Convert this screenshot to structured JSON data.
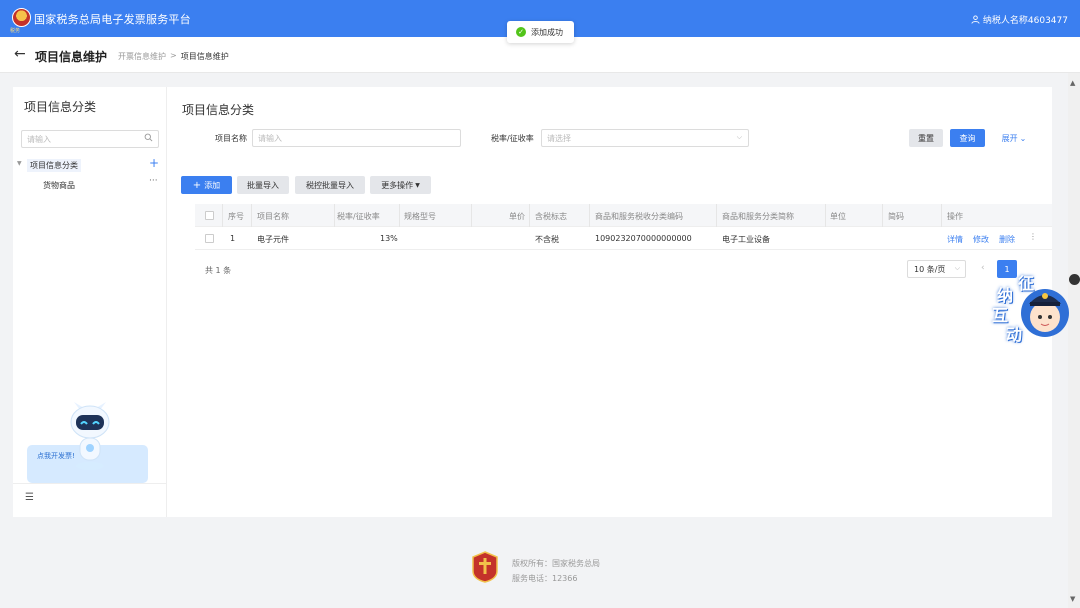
{
  "header": {
    "title": "国家税务总局电子发票服务平台",
    "logo_caption": "税务",
    "user": "纳税人名称4603477"
  },
  "toast": {
    "message": "添加成功"
  },
  "page": {
    "back": "←",
    "title": "项目信息维护",
    "breadcrumb": [
      "开票信息维护",
      "项目信息维护"
    ],
    "breadcrumb_sep": ">"
  },
  "sidebar": {
    "title": "项目信息分类",
    "search_placeholder": "请输入",
    "tree": {
      "root": "项目信息分类",
      "children": [
        "货物商品"
      ]
    },
    "bubble": "点我开发票!",
    "menu_icon": "☰"
  },
  "content": {
    "title": "项目信息分类",
    "filters": {
      "name_label": "项目名称",
      "name_placeholder": "请输入",
      "rate_label": "税率/征收率",
      "rate_placeholder": "请选择"
    },
    "actions": {
      "reset": "重置",
      "query": "查询",
      "expand": "展开"
    },
    "toolbar": {
      "add": "添加",
      "batch_import": "批量导入",
      "tax_batch_import": "税控批量导入",
      "more": "更多操作"
    },
    "table": {
      "headers": [
        "序号",
        "项目名称",
        "税率/征收率",
        "规格型号",
        "单价",
        "含税标志",
        "商品和服务税收分类编码",
        "商品和服务分类简称",
        "单位",
        "简码",
        "操作"
      ],
      "rows": [
        {
          "index": "1",
          "name": "电子元件",
          "rate": "13%",
          "spec": "",
          "price": "",
          "tax_flag": "不含税",
          "code": "1090232070000000000",
          "category": "电子工业设备",
          "unit": "",
          "short_code": "",
          "ops": [
            "详情",
            "修改",
            "删除"
          ]
        }
      ]
    },
    "pagination": {
      "total": "共 1 条",
      "page_size": "10 条/页",
      "current_page": "1"
    }
  },
  "mascot": {
    "chars": [
      "征",
      "纳",
      "互",
      "动"
    ]
  },
  "footer": {
    "copyright": "版权所有：国家税务总局",
    "phone": "服务电话：12366"
  },
  "colors": {
    "primary": "#3b7ff0",
    "success": "#52c41a"
  }
}
